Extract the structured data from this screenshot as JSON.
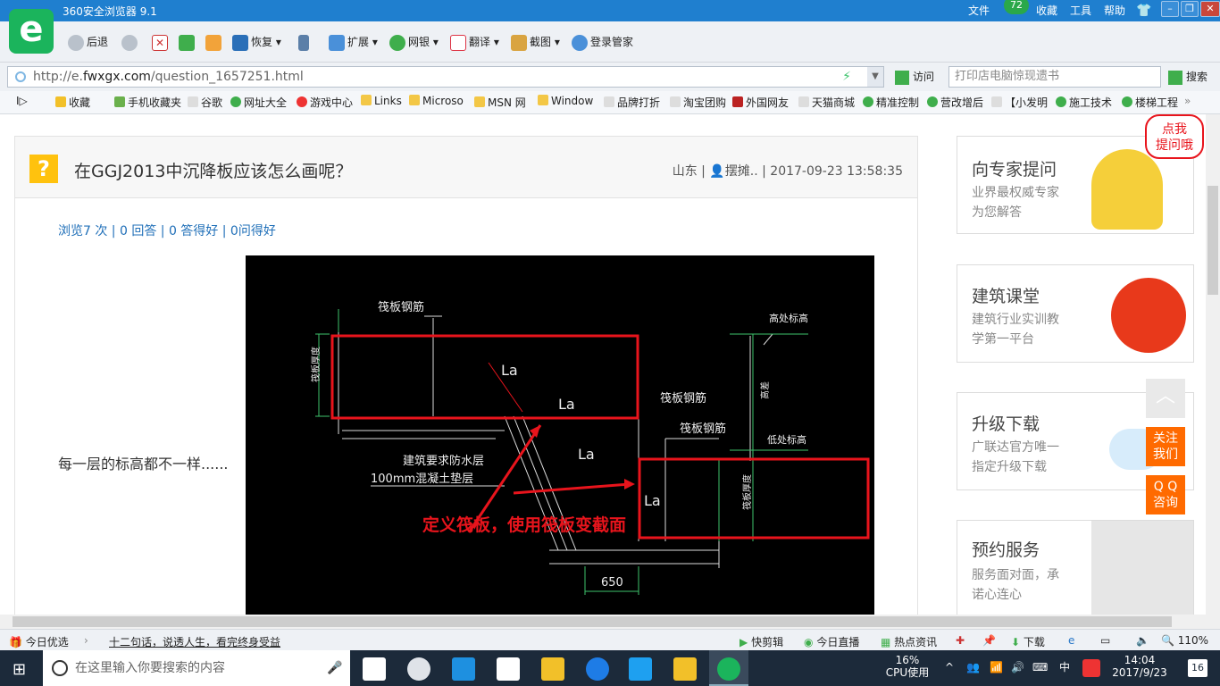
{
  "browser": {
    "title": "360安全浏览器 9.1",
    "menu": [
      "文件",
      "收藏",
      "工具",
      "帮助"
    ],
    "badge": "72"
  },
  "toolbar": {
    "back": "后退",
    "restore": "恢复",
    "extend": "扩展",
    "netbank": "网银",
    "translate": "翻译",
    "screenshot": "截图",
    "login": "登录管家"
  },
  "address": {
    "prefix": "http://e.",
    "domain": "fwxgx.com",
    "path": "/question_1657251.html",
    "visit": "访问",
    "search_placeholder": "打印店电脑惊现遗书",
    "search_button": "搜索"
  },
  "bookmarks": [
    "收藏",
    "手机收藏夹",
    "谷歌",
    "网址大全",
    "游戏中心",
    "Links",
    "Microso",
    "MSN 网",
    "Window",
    "品牌打折",
    "淘宝团购",
    "外国网友",
    "天猫商城",
    "精准控制",
    "营改增后",
    "【小发明",
    "施工技术",
    "楼梯工程"
  ],
  "question": {
    "title": "在GGJ2013中沉降板应该怎么画呢？",
    "meta": "山东 | 👤摆摊.. | 2017-09-23 13:58:35",
    "stats": "浏览7 次 | 0 回答 | 0 答得好 | 0问得好",
    "description": "每一层的标高都不一样......"
  },
  "cad": {
    "label_raft1": "筏板钢筋",
    "label_raft2": "筏板钢筋",
    "label_raft3": "筏板钢筋",
    "label_high": "高处标高",
    "label_low": "低处标高",
    "label_thick1": "筏板厚度",
    "label_thick2": "筏板厚度",
    "label_h": "高差",
    "la1": "La",
    "la2": "La",
    "la3": "La",
    "la4": "La",
    "layer1": "建筑要求防水层",
    "layer2": "100mm混凝土垫层",
    "dim": "650",
    "annotation": "定义筏板，使用筏板变截面"
  },
  "sidebar": [
    {
      "title": "向专家提问",
      "sub1": "业界最权威专家",
      "sub2": "为您解答"
    },
    {
      "title": "建筑课堂",
      "sub1": "建筑行业实训教",
      "sub2": "学第一平台"
    },
    {
      "title": "升级下载",
      "sub1": "广联达官方唯一",
      "sub2": "指定升级下载"
    },
    {
      "title": "预约服务",
      "sub1": "服务面对面，承",
      "sub2": "诺心连心"
    }
  ],
  "float": {
    "bubble": "点我\n提问哦",
    "follow": "关注\n我们",
    "qq": "Q Q\n咨询"
  },
  "status": {
    "today": "今日优选",
    "news": "十二句话，说透人生，看完终身受益",
    "items": [
      "快剪辑",
      "今日直播",
      "热点资讯",
      "下载",
      "110%"
    ]
  },
  "taskbar": {
    "search": "在这里输入你要搜索的内容",
    "cpu": "16%",
    "cpu_label": "CPU使用",
    "ime": "中",
    "time": "14:04",
    "date": "2017/9/23",
    "notif": "16"
  },
  "colors": {
    "accent": "#1f7fcf",
    "orange": "#ff6a00",
    "red": "#e8141c"
  }
}
